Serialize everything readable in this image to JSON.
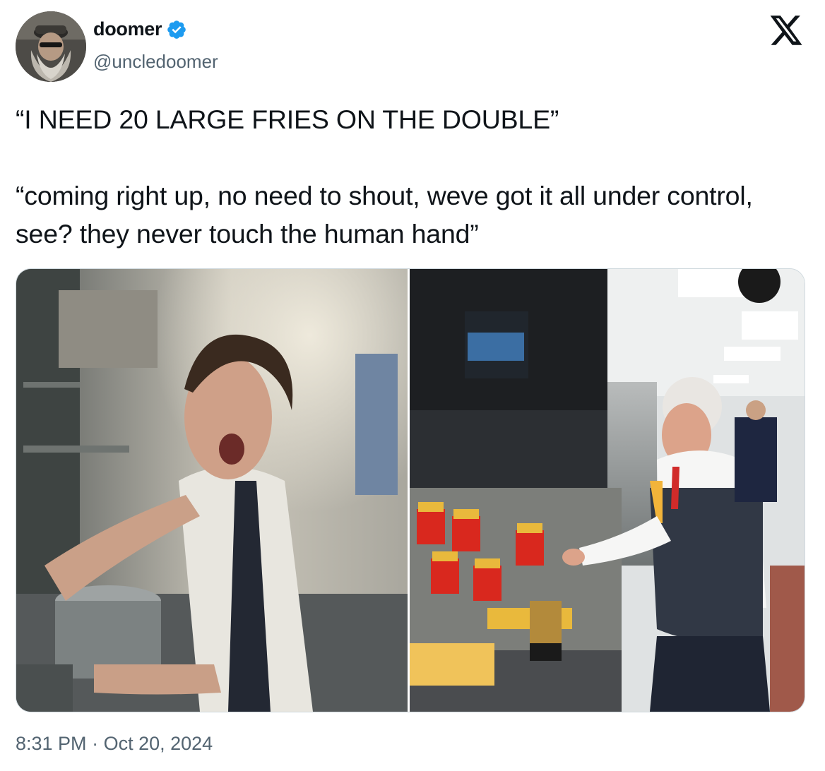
{
  "author": {
    "display_name": "doomer",
    "handle": "@uncledoomer",
    "verified": true,
    "avatar_icon": "bearded-man-avatar",
    "verified_icon": "verified-badge-icon"
  },
  "platform_logo": "x-logo-icon",
  "tweet": {
    "line1": "“I NEED 20 LARGE FRIES ON THE DOUBLE”",
    "line2": "“coming right up, no need to shout, weve got it all under control, see? they never touch the human hand”"
  },
  "media": [
    {
      "kind": "photo",
      "subject": "shouting-chef-kitchen"
    },
    {
      "kind": "photo",
      "subject": "man-at-fry-station"
    }
  ],
  "meta": {
    "time": "8:31 PM",
    "separator": "·",
    "date": "Oct 20, 2024"
  },
  "colors": {
    "verified_blue": "#1d9bf0",
    "text_primary": "#0f1419",
    "text_secondary": "#536471"
  }
}
